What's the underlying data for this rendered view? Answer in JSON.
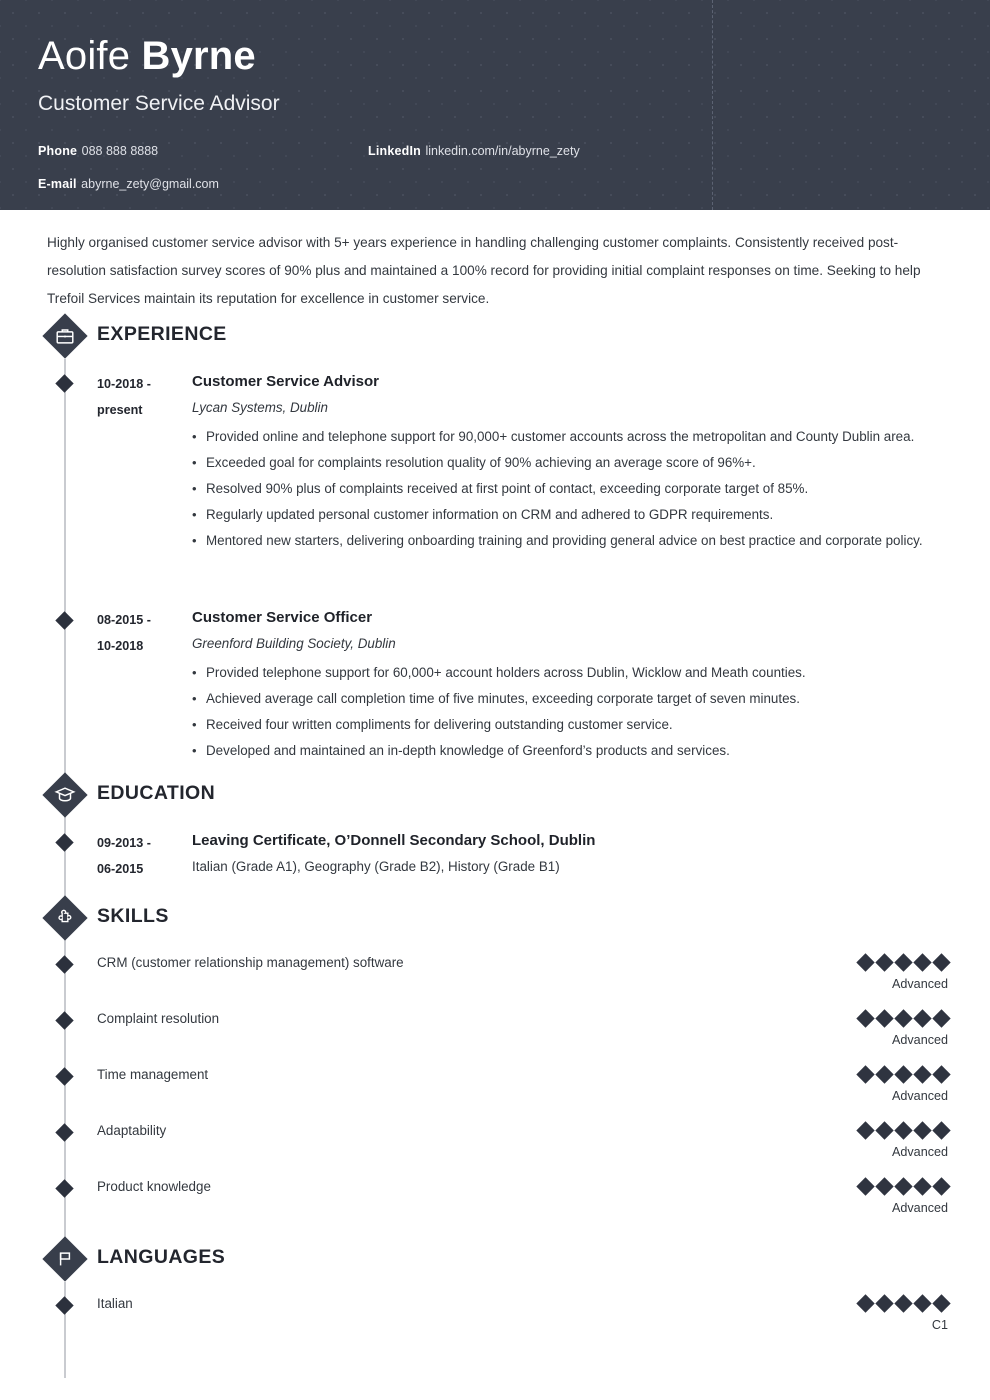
{
  "header": {
    "first_name": "Aoife",
    "last_name": "Byrne",
    "job_title": "Customer Service Advisor",
    "bg_color": "#393f4c",
    "contacts": [
      {
        "label": "Phone",
        "value": "088 888 8888",
        "column": "left"
      },
      {
        "label": "LinkedIn",
        "value": "linkedin.com/in/abyrne_zety",
        "column": "right"
      },
      {
        "label": "E-mail",
        "value": "abyrne_zety@gmail.com",
        "column": "left"
      }
    ]
  },
  "summary": "Highly organised customer service advisor with 5+ years experience in handling challenging customer complaints. Consistently received post-resolution satisfaction survey scores of 90% plus and maintained a 100% record for providing initial complaint responses on time. Seeking to help Trefoil Services maintain its reputation for excellence in customer service.",
  "sections": {
    "experience": {
      "title": "EXPERIENCE",
      "icon": "briefcase-icon",
      "entries": [
        {
          "dates": "10-2018 - present",
          "date_line_1": "10-2018 -",
          "date_line_2": "present",
          "role": "Customer Service Advisor",
          "company": "Lycan Systems, Dublin",
          "bullets": [
            "Provided online and telephone support for 90,000+ customer accounts across the metropolitan and County Dublin area.",
            "Exceeded goal for complaints resolution quality of 90% achieving an average score of 96%+.",
            "Resolved 90% plus of complaints received at first point of contact, exceeding corporate target of 85%.",
            "Regularly updated personal customer information on CRM and adhered to GDPR requirements.",
            "Mentored new starters, delivering onboarding training and providing general advice on best practice and corporate policy."
          ]
        },
        {
          "dates": "08-2015 - 10-2018",
          "date_line_1": "08-2015 -",
          "date_line_2": "10-2018",
          "role": "Customer Service Officer",
          "company": "Greenford Building Society, Dublin",
          "bullets": [
            "Provided telephone support for 60,000+ account holders across Dublin, Wicklow and Meath counties.",
            "Achieved average call completion time of five minutes, exceeding corporate target of seven minutes.",
            "Received four written compliments for delivering outstanding customer service.",
            "Developed and maintained an in-depth knowledge of Greenford’s products and services."
          ]
        }
      ]
    },
    "education": {
      "title": "EDUCATION",
      "icon": "graduation-cap-icon",
      "entries": [
        {
          "date_line_1": "09-2013 -",
          "date_line_2": "06-2015",
          "degree": "Leaving Certificate, O’Donnell Secondary School, Dublin",
          "detail": "Italian (Grade A1), Geography (Grade B2), History (Grade B1)"
        }
      ]
    },
    "skills": {
      "title": "SKILLS",
      "icon": "puzzle-piece-icon",
      "items": [
        {
          "label": "CRM (customer relationship management) software",
          "rating": 5,
          "max": 5,
          "level": "Advanced"
        },
        {
          "label": "Complaint resolution",
          "rating": 5,
          "max": 5,
          "level": "Advanced"
        },
        {
          "label": "Time management",
          "rating": 5,
          "max": 5,
          "level": "Advanced"
        },
        {
          "label": "Adaptability",
          "rating": 5,
          "max": 5,
          "level": "Advanced"
        },
        {
          "label": "Product knowledge",
          "rating": 5,
          "max": 5,
          "level": "Advanced"
        }
      ]
    },
    "languages": {
      "title": "LANGUAGES",
      "icon": "flag-icon",
      "items": [
        {
          "label": "Italian",
          "rating": 5,
          "max": 5,
          "level": "C1"
        }
      ]
    }
  }
}
